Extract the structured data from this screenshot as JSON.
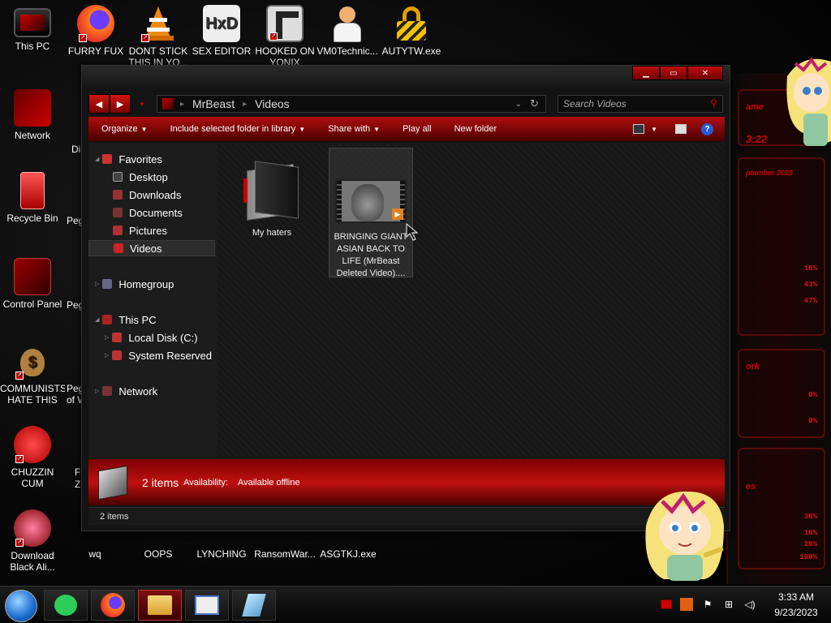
{
  "desktop": {
    "icons": [
      {
        "label": "This PC"
      },
      {
        "label": "FURRY FUX"
      },
      {
        "label": "DONT STICK THIS IN YO..."
      },
      {
        "label": "SEX EDITOR"
      },
      {
        "label": "HOOKED ON YONIX"
      },
      {
        "label": "VM0Technic..."
      },
      {
        "label": "AUTYTW.exe"
      },
      {
        "label": "Network"
      },
      {
        "label": "Recycle Bin"
      },
      {
        "label": "Control Panel"
      },
      {
        "label": "COMMUNISTS HATE THIS G..."
      },
      {
        "label": "CHUZZIN CUM"
      },
      {
        "label": "Download Black Ali..."
      },
      {
        "label": "wq"
      },
      {
        "label": "OOPS"
      },
      {
        "label": "LYNCHING"
      },
      {
        "label": "RansomWar..."
      },
      {
        "label": "ASGTKJ.exe"
      }
    ],
    "partial_labels": [
      "Di",
      "Peg",
      "Peg",
      "Peg",
      "of W",
      "F",
      "Z"
    ]
  },
  "hud": {
    "titles": [
      "ame",
      "3:22",
      "ptember 2023",
      "ork",
      "es"
    ],
    "readouts": [
      "16%",
      "43%",
      "47%",
      "0%",
      "0%",
      "36%",
      "16%",
      "26%",
      "100%"
    ]
  },
  "window": {
    "address": {
      "crumbs": [
        "MrBeast",
        "Videos"
      ]
    },
    "search": {
      "placeholder": "Search Videos"
    },
    "toolbar": {
      "organize": "Organize",
      "include": "Include selected folder in library",
      "share": "Share with",
      "play_all": "Play all",
      "new_folder": "New folder",
      "help": "?"
    },
    "nav": {
      "favorites": "Favorites",
      "desktop": "Desktop",
      "downloads": "Downloads",
      "documents": "Documents",
      "pictures": "Pictures",
      "videos": "Videos",
      "homegroup": "Homegroup",
      "this_pc": "This PC",
      "local_disk": "Local Disk (C:)",
      "system_reserved": "System Reserved",
      "network": "Network"
    },
    "items": [
      {
        "label": "My haters",
        "type": "folder"
      },
      {
        "label": "BRINGING GIANT ASIAN BACK TO LIFE (MrBeast Deleted Video)....",
        "type": "video"
      }
    ],
    "details": {
      "count": "2 items",
      "availability_label": "Availability:",
      "availability_value": "Available offline"
    },
    "status": {
      "count": "2 items"
    }
  },
  "taskbar": {
    "time": "3:33 AM",
    "date": "9/23/2023"
  },
  "colors": {
    "accent": "#c01010",
    "dark": "#141414"
  }
}
